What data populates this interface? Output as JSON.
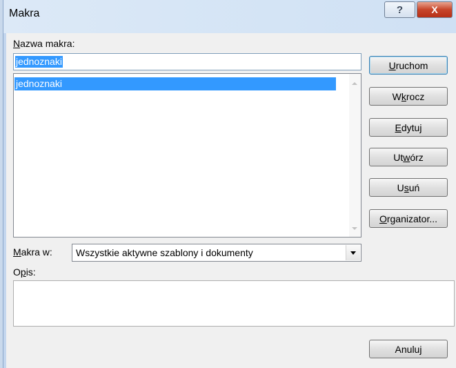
{
  "window": {
    "title": "Makra",
    "help_glyph": "?",
    "close_glyph": "X"
  },
  "name_field": {
    "label_u": "N",
    "label_rest": "azwa makra:",
    "value": "jednoznaki"
  },
  "macro_list": {
    "items": [
      "jednoznaki"
    ]
  },
  "buttons": {
    "run": {
      "pre": "",
      "u": "U",
      "post": "ruchom"
    },
    "step_into": {
      "pre": "W",
      "u": "k",
      "post": "rocz"
    },
    "edit": {
      "pre": "",
      "u": "E",
      "post": "dytuj"
    },
    "create": {
      "pre": "Ut",
      "u": "w",
      "post": "órz"
    },
    "delete": {
      "pre": "U",
      "u": "s",
      "post": "uń"
    },
    "organizer": {
      "pre": "",
      "u": "O",
      "post": "rganizator..."
    },
    "cancel": {
      "label": "Anuluj"
    }
  },
  "macros_in": {
    "label_u": "M",
    "label_rest": "akra w:",
    "value": "Wszystkie aktywne szablony i dokumenty"
  },
  "description": {
    "label_pre": "O",
    "label_u": "p",
    "label_post": "is:",
    "value": ""
  },
  "colors": {
    "selection": "#3399ff",
    "close_button": "#c7452a"
  }
}
